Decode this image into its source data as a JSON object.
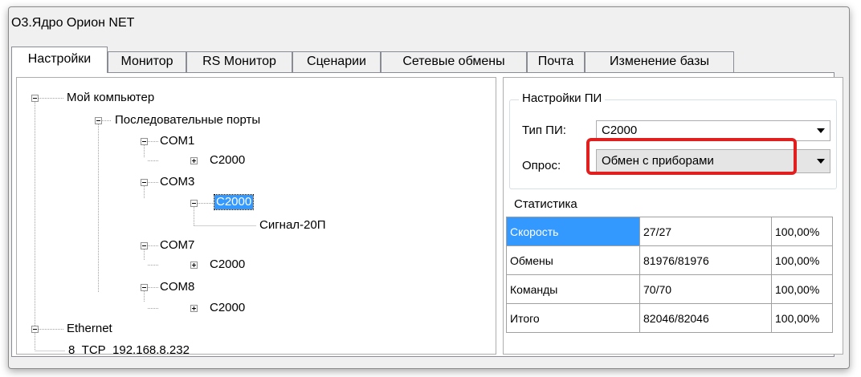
{
  "window": {
    "title": "О3.Ядро Орион NET"
  },
  "tabs": [
    {
      "label": "Настройки",
      "active": true
    },
    {
      "label": "Монитор"
    },
    {
      "label": "RS Монитор"
    },
    {
      "label": "Сценарии"
    },
    {
      "label": "Сетевые обмены"
    },
    {
      "label": "Почта"
    },
    {
      "label": "Изменение базы"
    }
  ],
  "tree": {
    "root": "Мой компьютер",
    "serial_ports": "Последовательные порты",
    "com1": {
      "label": "COM1",
      "device": "C2000"
    },
    "com3": {
      "label": "COM3",
      "device": "C2000",
      "child": "Сигнал-20П"
    },
    "com7": {
      "label": "COM7",
      "device": "C2000"
    },
    "com8": {
      "label": "COM8",
      "device": "C2000"
    },
    "ethernet": {
      "label": "Ethernet",
      "child": "8_TCP_192.168.8.232"
    }
  },
  "settings": {
    "group_title": "Настройки ПИ",
    "type_label": "Тип ПИ:",
    "type_value": "C2000",
    "poll_label": "Опрос:",
    "poll_value": "Обмен с приборами"
  },
  "statistics": {
    "title": "Статистика",
    "rows": [
      {
        "name": "Скорость",
        "value": "27/27",
        "percent": "100,00%"
      },
      {
        "name": "Обмены",
        "value": "81976/81976",
        "percent": "100,00%"
      },
      {
        "name": "Команды",
        "value": "70/70",
        "percent": "100,00%"
      },
      {
        "name": "Итого",
        "value": "82046/82046",
        "percent": "100,00%"
      }
    ]
  },
  "colors": {
    "selection": "#3399ff",
    "highlight": "#e21f1f"
  }
}
